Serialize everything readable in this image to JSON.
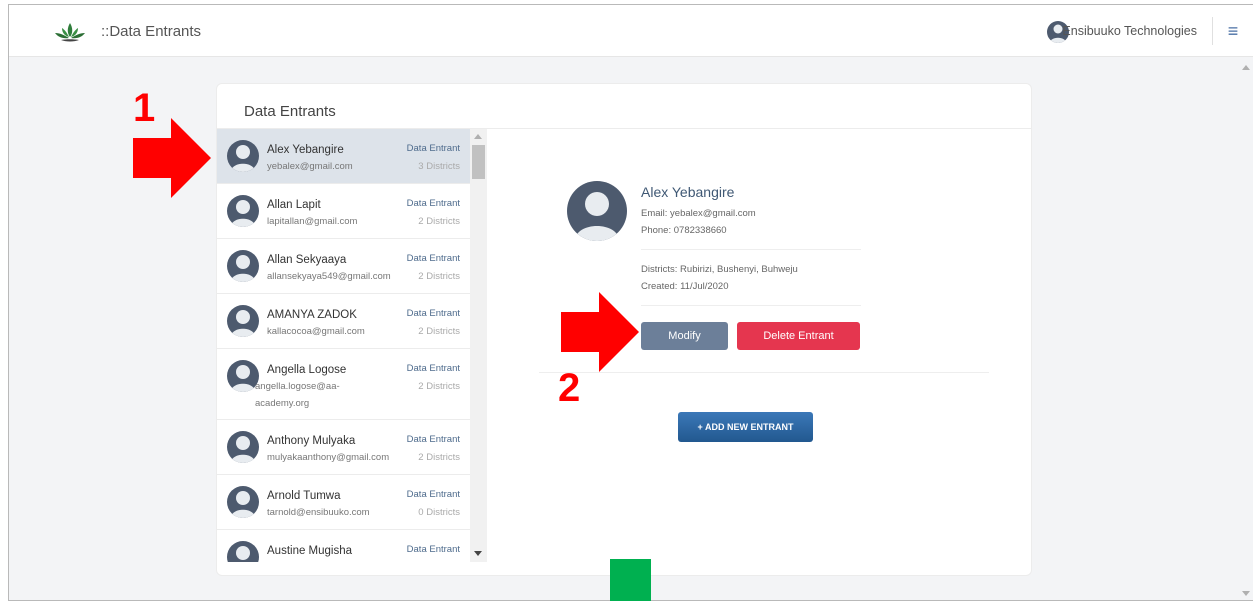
{
  "app": {
    "title": "::Data Entrants",
    "user_name": "Ensibuuko Technologies",
    "menu_icon": "hamburger-icon"
  },
  "card": {
    "title": "Data Entrants"
  },
  "entrants": [
    {
      "name": "Alex Yebangire",
      "email": "yebalex@gmail.com",
      "role": "Data Entrant",
      "districts": "3 Districts"
    },
    {
      "name": "Allan Lapit",
      "email": "lapitallan@gmail.com",
      "role": "Data Entrant",
      "districts": "2 Districts"
    },
    {
      "name": "Allan Sekyaaya",
      "email": "allansekyaya549@gmail.com",
      "role": "Data Entrant",
      "districts": "2 Districts"
    },
    {
      "name": "AMANYA ZADOK",
      "email": "kallacocoa@gmail.com",
      "role": "Data Entrant",
      "districts": "2 Districts"
    },
    {
      "name": "Angella Logose",
      "email": "angella.logose@aa-academy.org",
      "role": "Data Entrant",
      "districts": "2 Districts"
    },
    {
      "name": "Anthony Mulyaka",
      "email": "mulyakaanthony@gmail.com",
      "role": "Data Entrant",
      "districts": "2 Districts"
    },
    {
      "name": "Arnold Tumwa",
      "email": "tarnold@ensibuuko.com",
      "role": "Data Entrant",
      "districts": "0 Districts"
    },
    {
      "name": "Austine Mugisha",
      "email": "",
      "role": "Data Entrant",
      "districts": ""
    }
  ],
  "selected": {
    "name": "Alex Yebangire",
    "email": "Email: yebalex@gmail.com",
    "phone": "Phone: 0782338660",
    "districts": "Districts: Rubirizi, Bushenyi, Buhweju",
    "created": "Created: 11/Jul/2020"
  },
  "actions": {
    "modify": "Modify",
    "delete": "Delete Entrant",
    "add_new": "+ ADD NEW ENTRANT"
  },
  "annotations": {
    "step1": "1",
    "step2": "2",
    "arrow_color": "#ff0000",
    "marker_color": "#00b050"
  }
}
